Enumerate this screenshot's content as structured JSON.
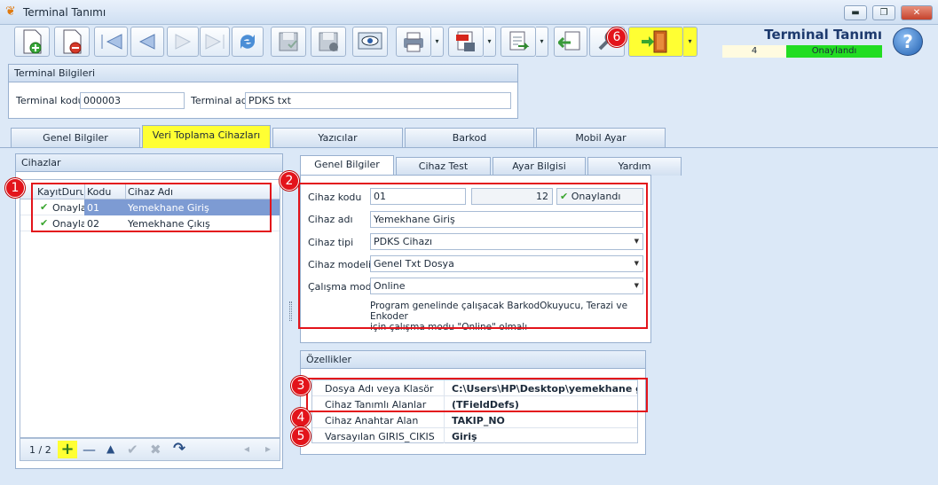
{
  "window": {
    "title": "Terminal Tanımı",
    "min_glyph": "▬",
    "max_glyph": "❐",
    "close_glyph": "✕"
  },
  "toolbar": {
    "dropdown_glyph": "▾",
    "badge": "6",
    "header_title": "Terminal Tanımı",
    "record_no": "4",
    "status": "Onaylandı",
    "status_color": "#22dd22",
    "accent_highlight": "#ffff33",
    "help_glyph": "?",
    "icons": [
      "new-record-icon",
      "delete-record-icon",
      "first-record-icon",
      "previous-record-icon",
      "next-record-icon",
      "last-record-icon",
      "refresh-icon",
      "save-icon",
      "cancel-save-icon",
      "preview-icon",
      "print-icon",
      "pdf-export-icon",
      "export-icon",
      "import-icon",
      "tools-icon",
      "exit-door-icon",
      "help-icon"
    ]
  },
  "terminal_info": {
    "header": "Terminal Bilgileri",
    "code_label": "Terminal kodu",
    "code_value": "000003",
    "name_label": "Terminal adı",
    "name_value": "PDKS txt"
  },
  "main_tabs": [
    "Genel Bilgiler",
    "Veri Toplama Cihazları",
    "Yazıcılar",
    "Barkod",
    "Mobil Ayar"
  ],
  "devices": {
    "header": "Cihazlar",
    "badge": "1",
    "columns": [
      "KayıtDurumu",
      "Kodu",
      "Cihaz Adı"
    ],
    "rows": [
      {
        "status": "Onaylandı",
        "code": "01",
        "name": "Yemekhane Giriş"
      },
      {
        "status": "Onaylandı",
        "code": "02",
        "name": "Yemekhane Çıkış"
      }
    ],
    "pager": "1 / 2",
    "nav_glyphs": {
      "add": "+",
      "remove": "—",
      "up": "▲",
      "confirm": "✔",
      "cancel": "✖",
      "redo": "↷",
      "left": "◂",
      "right": "▸"
    }
  },
  "sub_tabs": [
    "Genel Bilgiler",
    "Cihaz Test",
    "Ayar Bilgisi",
    "Yardım"
  ],
  "device_form": {
    "badge": "2",
    "code_label": "Cihaz kodu",
    "code_value": "01",
    "count_value": "12",
    "status_value": "Onaylandı",
    "name_label": "Cihaz adı",
    "name_value": "Yemekhane Giriş",
    "type_label": "Cihaz tipi",
    "type_value": "PDKS Cihazı",
    "model_label": "Cihaz modeli",
    "model_value": "Genel Txt Dosya",
    "mode_label": "Çalışma modu",
    "mode_value": "Online",
    "note_line1": "Program genelinde çalışacak BarkodOkuyucu, Terazi ve Enkoder",
    "note_line2": "için çalışma modu \"Online\" olmalı",
    "combo_arrow": "▼"
  },
  "properties": {
    "header": "Özellikler",
    "rows": [
      {
        "badge": "3",
        "name": "Dosya Adı veya Klasör",
        "value": "C:\\Users\\HP\\Desktop\\yemekhane gi"
      },
      {
        "badge": "",
        "name": "Cihaz Tanımlı Alanlar",
        "value": "(TFieldDefs)"
      },
      {
        "badge": "4",
        "name": "Cihaz Anahtar Alan",
        "value": "TAKIP_NO"
      },
      {
        "badge": "5",
        "name": "Varsayılan GIRIS_CIKIS",
        "value": "Giriş"
      }
    ]
  }
}
